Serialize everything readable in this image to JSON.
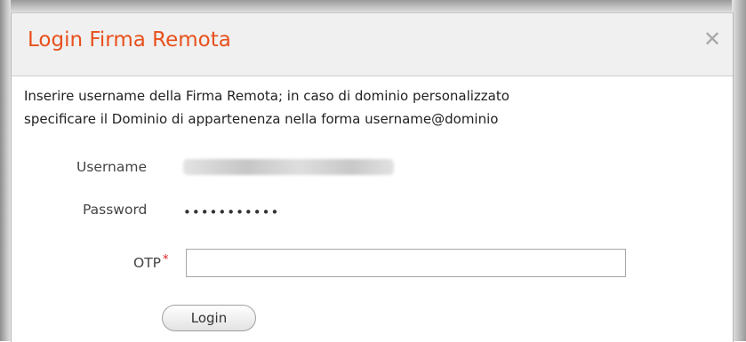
{
  "dialog": {
    "title": "Login Firma Remota",
    "close_icon": "close-icon",
    "intro_line1": "Inserire username della Firma Remota; in caso di dominio personalizzato",
    "intro_line2": "specificare il Dominio di appartenenza nella forma username@dominio"
  },
  "form": {
    "username_label": "Username",
    "username_value": "",
    "password_label": "Password",
    "password_value": "•••••••••••",
    "otp_label": "OTP",
    "otp_required_mark": "*",
    "otp_value": "",
    "login_button": "Login"
  },
  "colors": {
    "title": "#e8501c",
    "required": "#e02020",
    "titlebar_bg": "#f0f0f0"
  }
}
